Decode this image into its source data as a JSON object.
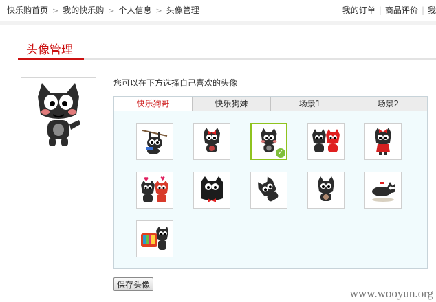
{
  "breadcrumb": [
    "快乐购首页",
    "我的快乐购",
    "个人信息",
    "头像管理"
  ],
  "top_links": [
    "我的订单",
    "商品评价",
    "我"
  ],
  "page_title": "头像管理",
  "hint": "您可以在下方选择自己喜欢的头像",
  "tabs": [
    {
      "label": "快乐狗哥",
      "active": true
    },
    {
      "label": "快乐狗妹",
      "active": false
    },
    {
      "label": "场景1",
      "active": false
    },
    {
      "label": "场景2",
      "active": false
    }
  ],
  "avatars": [
    {
      "icon": "dog-hanging-rope-icon"
    },
    {
      "icon": "dog-red-bow-icon"
    },
    {
      "icon": "dog-waving-icon",
      "selected": true
    },
    {
      "icon": "dog-pair-red-dog-icon"
    },
    {
      "icon": "dog-red-dress-icon"
    },
    {
      "icon": "dog-pair-hearts-icon"
    },
    {
      "icon": "dog-bowtie-icon"
    },
    {
      "icon": "dog-falling-icon"
    },
    {
      "icon": "dog-shy-icon"
    },
    {
      "icon": "dog-lying-icon"
    },
    {
      "icon": "dog-tv-icon"
    }
  ],
  "save_button": "保存头像",
  "watermark": "www.wooyun.org",
  "colors": {
    "accent": "#cc1111",
    "selected_border": "#8fc31f",
    "panel_bg": "#f1fbfd"
  }
}
